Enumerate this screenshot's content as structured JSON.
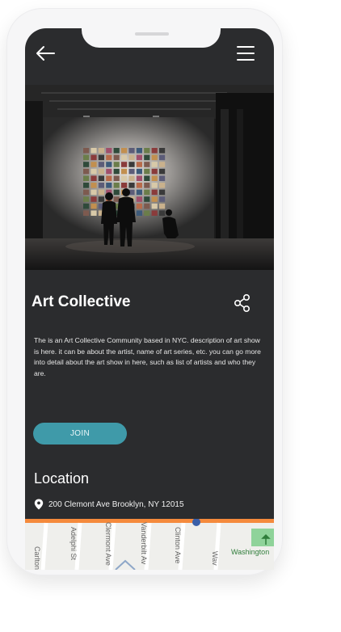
{
  "event": {
    "title": "Art Collective",
    "description": "The is an Art Collective Community based in NYC. description of art show is here. it can be about the artist, name of art series, etc. you can go more into detail about the art show in here, such as list of artists and who they are.",
    "join_label": "JOIN"
  },
  "location": {
    "heading": "Location",
    "address": "200 Clemont Ave Brooklyn, NY 12015"
  },
  "map": {
    "streets": [
      "Carlton",
      "Adelphi St",
      "Clermont Ave",
      "Vanderbilt Av",
      "Clinton Ave",
      "Wav"
    ],
    "place": "Washington"
  },
  "icons": {
    "back": "arrow-left-icon",
    "menu": "hamburger-menu-icon",
    "share": "share-icon",
    "pin": "map-pin-icon"
  },
  "colors": {
    "screen_bg": "#2b2c2e",
    "accent": "#3f9aa9",
    "map_route": "#f58a3c",
    "park": "#8fd39a"
  }
}
